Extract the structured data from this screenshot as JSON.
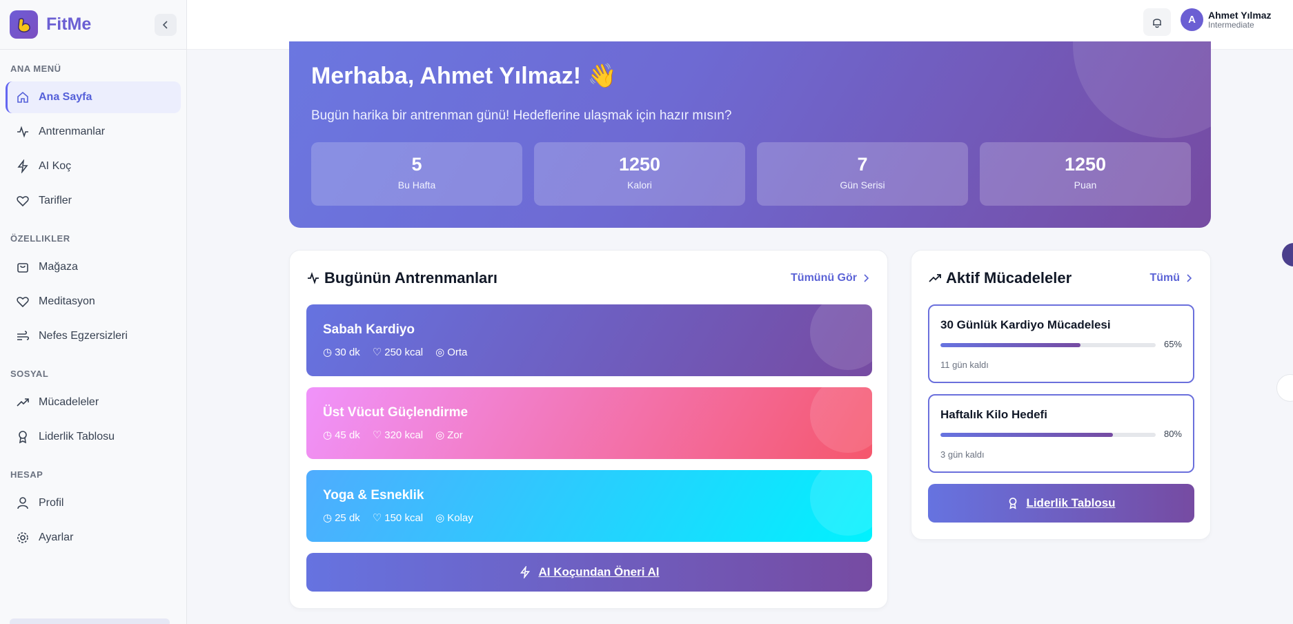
{
  "app": {
    "name": "FitMe"
  },
  "sidebar": {
    "sections": [
      {
        "title": "ANA MENÜ",
        "items": [
          "Ana Sayfa",
          "Antrenmanlar",
          "AI Koç",
          "Tarifler"
        ]
      },
      {
        "title": "ÖZELLIKLER",
        "items": [
          "Mağaza",
          "Meditasyon",
          "Nefes Egzersizleri"
        ]
      },
      {
        "title": "SOSYAL",
        "items": [
          "Mücadeleler",
          "Liderlik Tablosu"
        ]
      },
      {
        "title": "HESAP",
        "items": [
          "Profil",
          "Ayarlar"
        ]
      }
    ],
    "active_item": "Ana Sayfa"
  },
  "user": {
    "initial": "A",
    "name": "Ahmet Yılmaz",
    "level": "Intermediate"
  },
  "hero": {
    "title": "Merhaba, Ahmet Yılmaz! 👋",
    "subtitle": "Bugün harika bir antrenman günü! Hedeflerine ulaşmak için hazır mısın?",
    "stats": [
      {
        "value": "5",
        "label": "Bu Hafta"
      },
      {
        "value": "1250",
        "label": "Kalori"
      },
      {
        "value": "7",
        "label": "Gün Serisi"
      },
      {
        "value": "1250",
        "label": "Puan"
      }
    ]
  },
  "workouts": {
    "title": "Bugünün Antrenmanları",
    "link": "Tümünü Gör",
    "items": [
      {
        "name": "Sabah Kardiyo",
        "duration": "30 dk",
        "calories": "250 kcal",
        "level": "Orta"
      },
      {
        "name": "Üst Vücut Güçlendirme",
        "duration": "45 dk",
        "calories": "320 kcal",
        "level": "Zor"
      },
      {
        "name": "Yoga & Esneklik",
        "duration": "25 dk",
        "calories": "150 kcal",
        "level": "Kolay"
      }
    ],
    "ai_button": "AI Koçundan Öneri Al"
  },
  "challenges": {
    "title": "Aktif Mücadeleler",
    "link": "Tümü",
    "items": [
      {
        "name": "30 Günlük Kardiyo Mücadelesi",
        "progress": 0.65,
        "percent_label": "65%",
        "remaining": "11 gün kaldı"
      },
      {
        "name": "Haftalık Kilo Hedefi",
        "progress": 0.8,
        "percent_label": "80%",
        "remaining": "3 gün kaldı"
      }
    ],
    "leaderboard_button": "Liderlik Tablosu"
  },
  "colors": {
    "accent": "#6366f1",
    "brand": "#764ba2"
  }
}
